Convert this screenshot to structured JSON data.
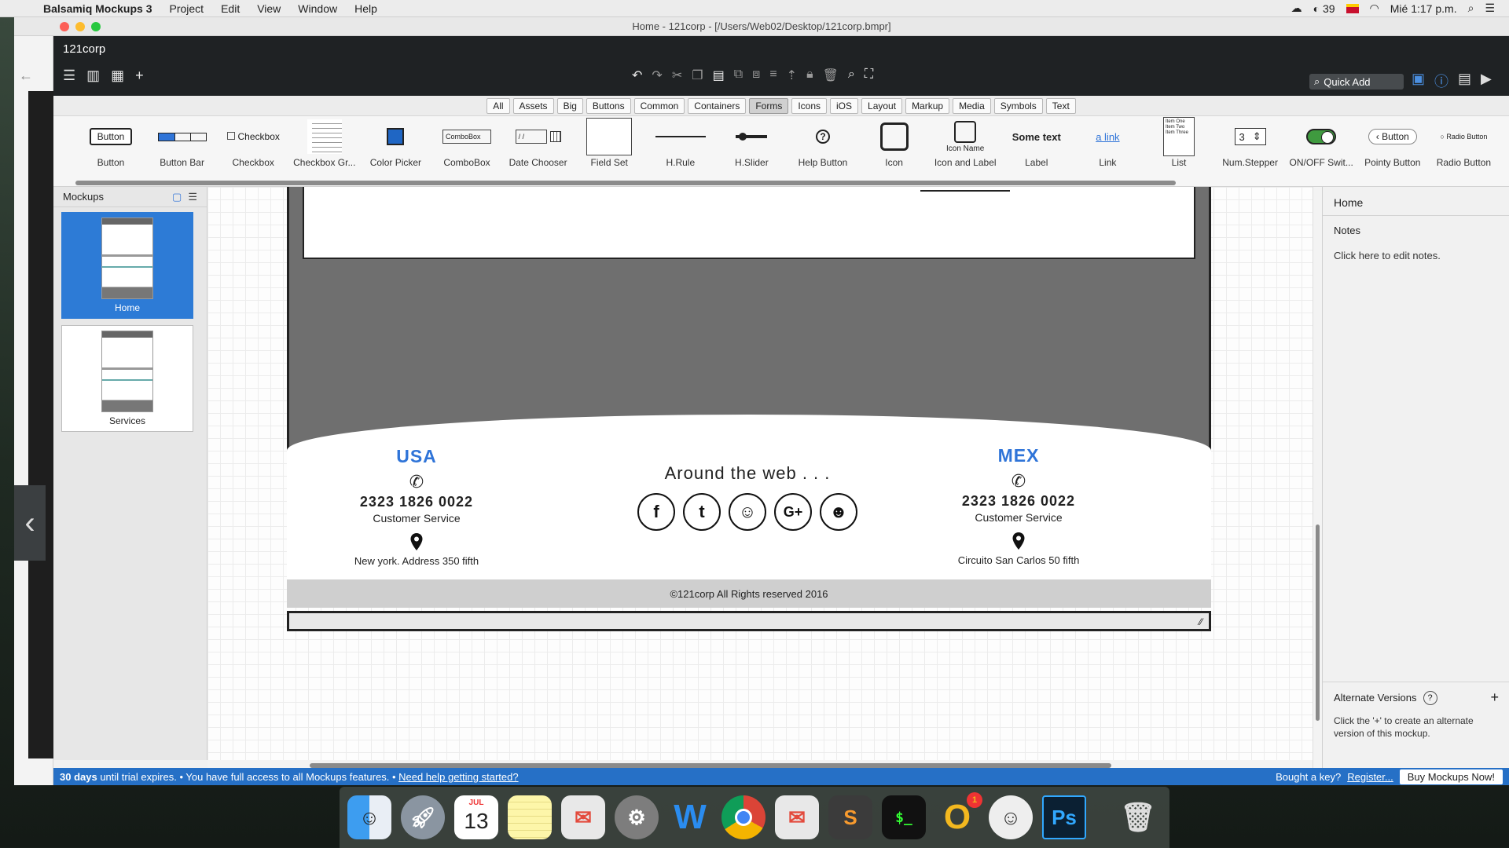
{
  "menubar": {
    "app": "Balsamiq Mockups 3",
    "items": [
      "Project",
      "Edit",
      "View",
      "Window",
      "Help"
    ],
    "status_count": "39",
    "clock": "Mié 1:17 p.m."
  },
  "window": {
    "title": "Home - 121corp - [/Users/Web02/Desktop/121corp.bmpr]",
    "project_name": "121corp",
    "quick_add": "Quick Add"
  },
  "filters": [
    "All",
    "Assets",
    "Big",
    "Buttons",
    "Common",
    "Containers",
    "Forms",
    "Icons",
    "iOS",
    "Layout",
    "Markup",
    "Media",
    "Symbols",
    "Text"
  ],
  "active_filter": "Forms",
  "library": {
    "items": [
      "Button",
      "Button Bar",
      "Checkbox",
      "Checkbox Gr...",
      "Color Picker",
      "ComboBox",
      "Date Chooser",
      "Field Set",
      "H.Rule",
      "H.Slider",
      "Help Button",
      "Icon",
      "Icon and Label",
      "Label",
      "Link",
      "List",
      "Num.Stepper",
      "ON/OFF Swit...",
      "Pointy Button",
      "Radio Button",
      "Radi"
    ],
    "glyph_text": {
      "button": "Button",
      "checkbox": "Checkbox",
      "combobox": "ComboBox",
      "date": "/ /",
      "icon_name": "Icon Name",
      "label": "Some text",
      "link": "a link",
      "stepper": "3",
      "pointy": "Button",
      "radio": "Radio Button",
      "help": "?",
      "list": [
        "Item One",
        "Item Two",
        "Item Three"
      ]
    }
  },
  "mockups_panel": {
    "title": "Mockups",
    "items": [
      {
        "label": "Home",
        "selected": true
      },
      {
        "label": "Services",
        "selected": false
      }
    ]
  },
  "mockup": {
    "usa": {
      "country": "USA",
      "phone": "2323 1826 0022",
      "service": "Customer Service",
      "address": "New york. Address 350 fifth"
    },
    "web": {
      "title": "Around the web . . .",
      "icons": [
        "facebook-icon",
        "twitter-icon",
        "snapchat-icon",
        "google-plus-icon",
        "github-icon"
      ],
      "icon_glyphs": [
        "f",
        "t",
        "☺",
        "G+",
        "☻"
      ]
    },
    "mex": {
      "country": "MEX",
      "phone": "2323 1826 0022",
      "service": "Customer Service",
      "address": "Circuito San Carlos 50 fifth"
    },
    "copyright": "©121corp All Rights  reserved 2016"
  },
  "inspector": {
    "title": "Home",
    "notes_label": "Notes",
    "notes_placeholder": "Click here to edit notes.",
    "alt_title": "Alternate Versions",
    "alt_desc": "Click the '+' to create an alternate version of this mockup."
  },
  "statusbar": {
    "trial_days": "30 days",
    "trial_text": " until trial expires. • You have full access to all Mockups features. • ",
    "help_link": "Need help getting started?",
    "key_text": "Bought a key?",
    "register_link": "Register...",
    "buy_button": "Buy Mockups Now!"
  },
  "dock": {
    "apps": [
      "finder",
      "launchpad",
      "calendar",
      "notes",
      "mail-app",
      "system-preferences",
      "word-app",
      "chrome",
      "mail-app-2",
      "sublime-text",
      "terminal",
      "messenger-app",
      "emoji-app",
      "photoshop",
      "trash"
    ],
    "calendar_month": "JUL",
    "calendar_day": "13",
    "terminal_text": "$_",
    "photoshop_text": "Ps",
    "badge_count": "1"
  },
  "colors": {
    "accent_blue": "#2f74d8",
    "status_blue": "#2670c6",
    "header_dark": "#1f2224"
  }
}
